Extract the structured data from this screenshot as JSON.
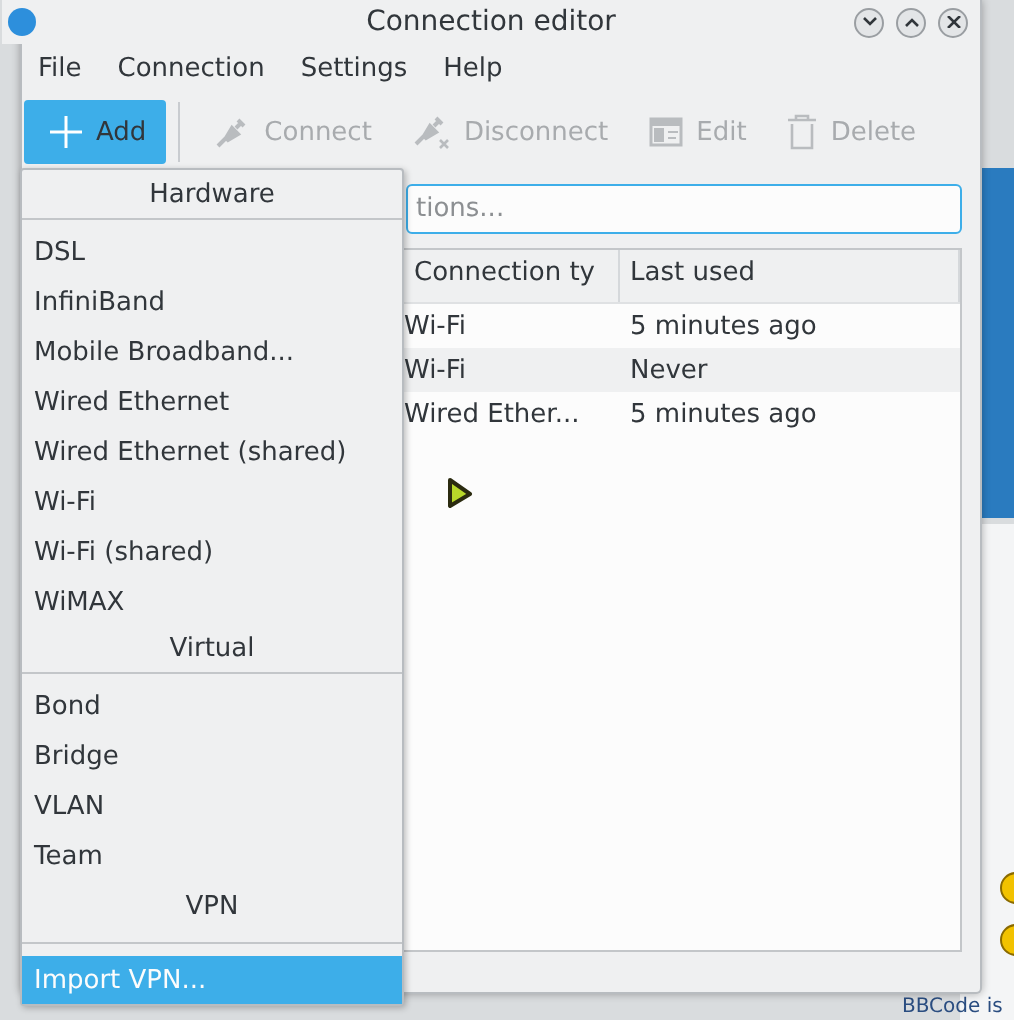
{
  "window": {
    "title": "Connection editor"
  },
  "menu_bar": [
    "File",
    "Connection",
    "Settings",
    "Help"
  ],
  "toolbar": [
    {
      "kind": "add",
      "label": "Add",
      "active": true,
      "disabled": false
    },
    {
      "kind": "connect",
      "label": "Connect",
      "active": false,
      "disabled": true
    },
    {
      "kind": "disconnect",
      "label": "Disconnect",
      "active": false,
      "disabled": true
    },
    {
      "kind": "edit",
      "label": "Edit",
      "active": false,
      "disabled": true
    },
    {
      "kind": "delete",
      "label": "Delete",
      "active": false,
      "disabled": true
    }
  ],
  "search": {
    "placeholder": "tions..."
  },
  "table": {
    "columns": [
      "Connection ty",
      "Last used"
    ],
    "rows": [
      [
        "Wi-Fi",
        "5 minutes ago"
      ],
      [
        "Wi-Fi",
        "Never"
      ],
      [
        "Wired Ether...",
        "5 minutes ago"
      ]
    ]
  },
  "add_menu": [
    {
      "kind": "header",
      "label": "Hardware"
    },
    {
      "kind": "item",
      "label": "DSL",
      "selected": false
    },
    {
      "kind": "item",
      "label": "InfiniBand",
      "selected": false
    },
    {
      "kind": "item",
      "label": "Mobile Broadband...",
      "selected": false
    },
    {
      "kind": "item",
      "label": "Wired Ethernet",
      "selected": false
    },
    {
      "kind": "item",
      "label": "Wired Ethernet (shared)",
      "selected": false
    },
    {
      "kind": "item",
      "label": "Wi-Fi",
      "selected": false
    },
    {
      "kind": "item",
      "label": "Wi-Fi (shared)",
      "selected": false
    },
    {
      "kind": "item",
      "label": "WiMAX",
      "selected": false
    },
    {
      "kind": "header",
      "label": "Virtual"
    },
    {
      "kind": "item",
      "label": "Bond",
      "selected": false
    },
    {
      "kind": "item",
      "label": "Bridge",
      "selected": false
    },
    {
      "kind": "item",
      "label": "VLAN",
      "selected": false
    },
    {
      "kind": "item",
      "label": "Team",
      "selected": false
    },
    {
      "kind": "header",
      "label": "VPN"
    },
    {
      "kind": "separator"
    },
    {
      "kind": "item",
      "label": "Import VPN...",
      "selected": true
    }
  ],
  "background": {
    "text": "BBCode is"
  }
}
